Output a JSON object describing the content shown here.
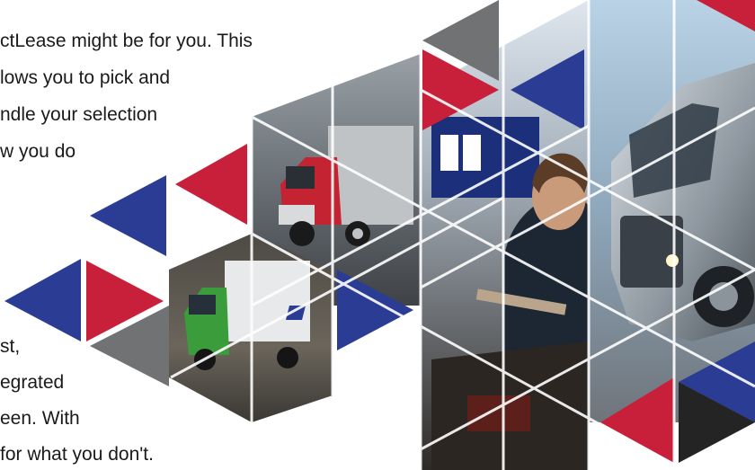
{
  "copy": {
    "paragraph_top": [
      "ctLease might be for you. This",
      "lows you to pick and",
      "ndle your selection",
      "w you do"
    ],
    "paragraph_bottom": [
      "st,",
      "egrated",
      "een. With",
      "for what you don't."
    ]
  },
  "photos": {
    "red_truck": "red box truck on road",
    "green_truck": "green box truck with logo",
    "mechanic": "mechanic working on engine",
    "silver_truck": "silver semi truck"
  },
  "colors": {
    "red": "#c8203a",
    "blue": "#2b3c94",
    "gray": "#707274",
    "black": "#242424"
  }
}
